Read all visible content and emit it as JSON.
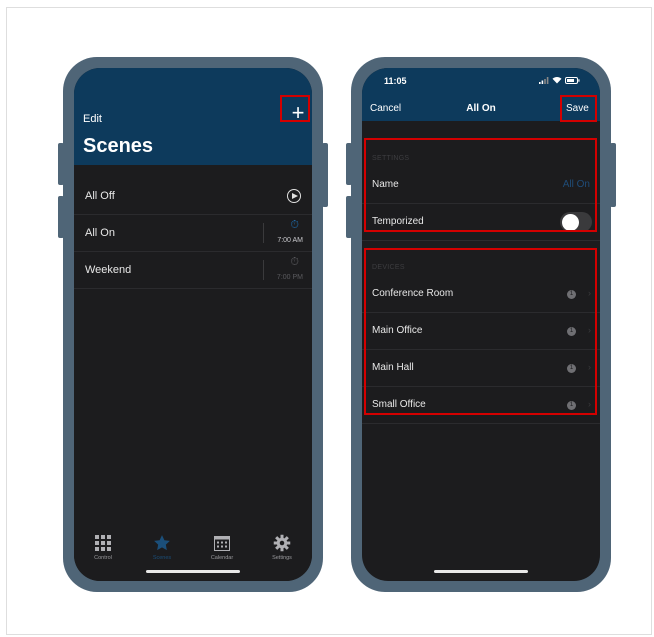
{
  "left_phone": {
    "header": {
      "edit_label": "Edit",
      "add_label": "+",
      "title": "Scenes"
    },
    "scenes": [
      {
        "name": "All Off",
        "action": "play"
      },
      {
        "name": "All On",
        "action": "timer",
        "time": "7:00 AM",
        "color": "#1f6aa8"
      },
      {
        "name": "Weekend",
        "action": "timer",
        "time": "7:00 PM",
        "color": "#3d3d40"
      }
    ],
    "tabs": [
      {
        "label": "Control",
        "icon": "grid-icon",
        "active": false
      },
      {
        "label": "Scenes",
        "icon": "star-icon",
        "active": true
      },
      {
        "label": "Calendar",
        "icon": "calendar-icon",
        "active": false
      },
      {
        "label": "Settings",
        "icon": "gear-icon",
        "active": false
      }
    ]
  },
  "right_phone": {
    "status_bar": {
      "time": "11:05"
    },
    "nav": {
      "cancel_label": "Cancel",
      "title": "All On",
      "save_label": "Save"
    },
    "settings": {
      "header": "SETTINGS",
      "name_label": "Name",
      "name_value": "All On",
      "temporized_label": "Temporized",
      "temporized_on": false
    },
    "devices": {
      "header": "DEVICES",
      "items": [
        {
          "name": "Conference Room",
          "count": "1"
        },
        {
          "name": "Main Office",
          "count": "1"
        },
        {
          "name": "Main Hall",
          "count": "1"
        },
        {
          "name": "Small Office",
          "count": "1"
        }
      ]
    }
  },
  "colors": {
    "header_bg": "#0d3a5c",
    "screen_bg": "#1c1c1e",
    "phone_frame": "#4f6577",
    "accent": "#1f6aa8",
    "highlight": "#d40000"
  }
}
